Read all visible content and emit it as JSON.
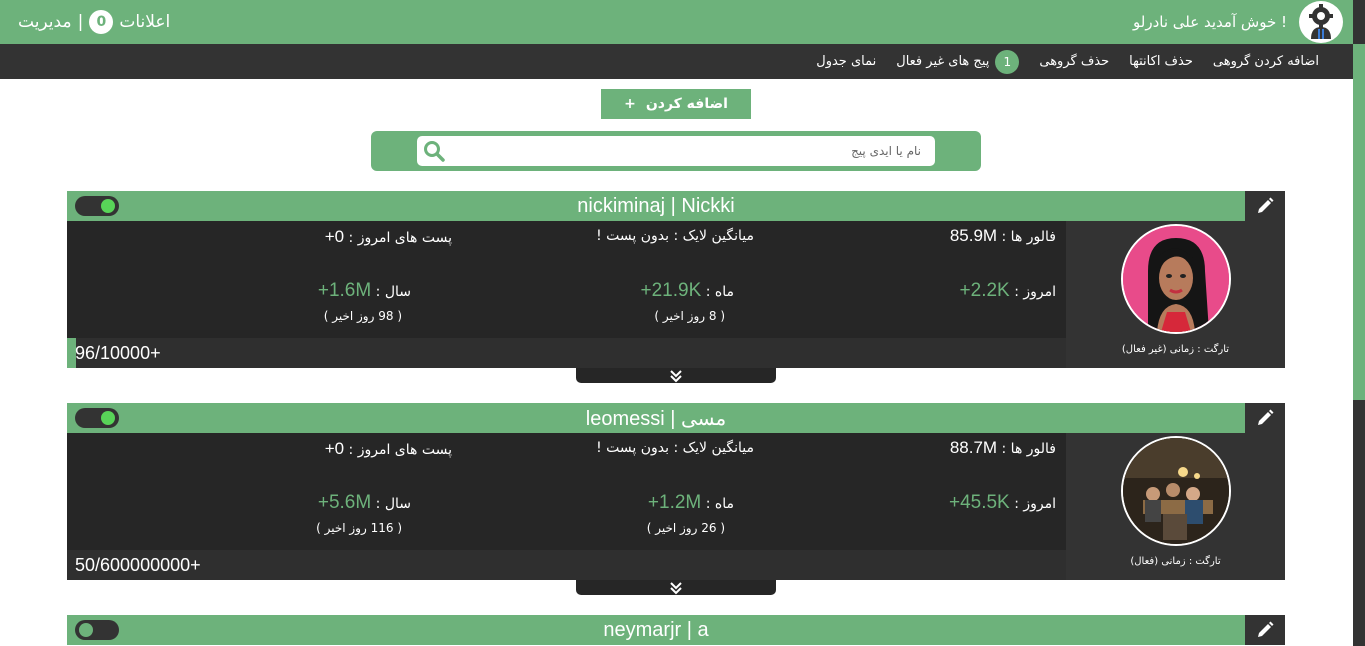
{
  "topbar": {
    "manage_label": "مدیریت",
    "separator": "|",
    "notifications_label": "اعلانات",
    "notifications_count": "0",
    "welcome_text": "خوش آمدید علی نادرلو !"
  },
  "nav": {
    "items": [
      {
        "label": "اضافه کردن گروهی"
      },
      {
        "label": "حذف اکانتها"
      },
      {
        "label": "حذف گروهی"
      },
      {
        "label": "پیج های غیر فعال",
        "count": "1"
      },
      {
        "label": "نمای جدول"
      }
    ]
  },
  "add_button": {
    "label": "اضافه کردن",
    "icon": "+"
  },
  "search": {
    "placeholder": "نام یا ایدی پیج"
  },
  "cards": [
    {
      "title": "nickiminaj | Nickki",
      "active": true,
      "followers_label": "فالور ها :",
      "followers": "85.9M",
      "avg_like_label": "میانگین لایک : بدون پست !",
      "posts_today_label": "پست های امروز :",
      "posts_today": "0+",
      "today_label": "امروز :",
      "today": "2.2K+",
      "month_label": "ماه :",
      "month": "21.9K+",
      "month_sub": "( 8 روز اخیر )",
      "year_label": "سال :",
      "year": "1.6M+",
      "year_sub": "( 98 روز اخیر )",
      "progress_text": "96/10000+",
      "progress_fraction": 0.0096,
      "target": "تارگت : زمانی (غیر فعال)",
      "avatar": "cartoon-avatar"
    },
    {
      "title": "leomessi | مسی",
      "active": true,
      "followers_label": "فالور ها :",
      "followers": "88.7M",
      "avg_like_label": "میانگین لایک : بدون پست !",
      "posts_today_label": "پست های امروز :",
      "posts_today": "0+",
      "today_label": "امروز :",
      "today": "45.5K+",
      "month_label": "ماه :",
      "month": "1.2M+",
      "month_sub": "( 26 روز اخیر )",
      "year_label": "سال :",
      "year": "5.6M+",
      "year_sub": "( 116 روز اخیر )",
      "progress_text": "50/600000000+",
      "progress_fraction": 0.0,
      "target": "تارگت : زمانی (فعال)",
      "avatar": "photo-avatar"
    },
    {
      "title": "neymarjr | a",
      "active": false
    }
  ],
  "colors": {
    "accent": "#6db27b",
    "dark": "#262626",
    "panel": "#333333",
    "toggle_on": "#58d458"
  }
}
